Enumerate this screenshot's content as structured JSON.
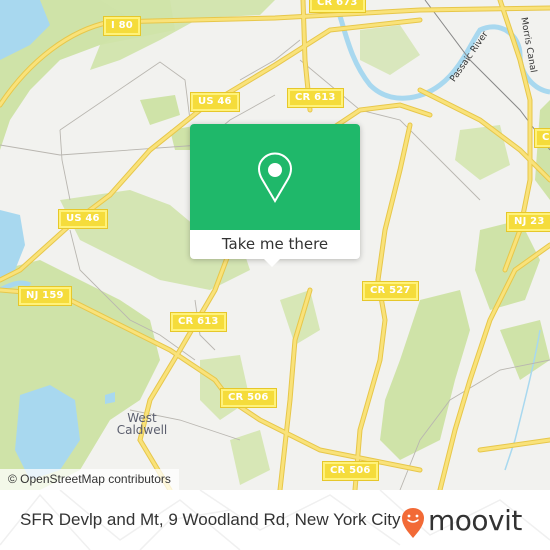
{
  "map": {
    "attribution": "© OpenStreetMap contributors",
    "road_shields": [
      {
        "id": "i80",
        "label": "I 80"
      },
      {
        "id": "us46-top",
        "label": "US 46"
      },
      {
        "id": "cr613-top",
        "label": "CR 613"
      },
      {
        "id": "cr673",
        "label": "CR 673"
      },
      {
        "id": "us46-left",
        "label": "US 46"
      },
      {
        "id": "nj159",
        "label": "NJ 159"
      },
      {
        "id": "cr613-mid",
        "label": "CR 613"
      },
      {
        "id": "cr506-mid",
        "label": "CR 506"
      },
      {
        "id": "cr527",
        "label": "CR 527"
      },
      {
        "id": "nj23",
        "label": "NJ 23"
      },
      {
        "id": "cr506-bottom",
        "label": "CR 506"
      },
      {
        "id": "cr-right",
        "label": "CR"
      }
    ],
    "places": [
      {
        "label_line1": "West",
        "label_line2": "Caldwell"
      }
    ],
    "water_labels": [
      "Passaic River",
      "Morris Canal"
    ],
    "colors": {
      "land": "#f2f2ef",
      "forest": "#cfe3a8",
      "water": "#a8d8ef",
      "road_major": "#f6dc5c",
      "road_minor": "#b9b6b0"
    }
  },
  "popup": {
    "cta_label": "Take me there",
    "icon": "map-pin-icon",
    "color": "#1fb86a"
  },
  "footer": {
    "address": "SFR Devlp and Mt, 9 Woodland Rd, New York City",
    "brand": "moovit",
    "brand_color": "#f26a36"
  }
}
